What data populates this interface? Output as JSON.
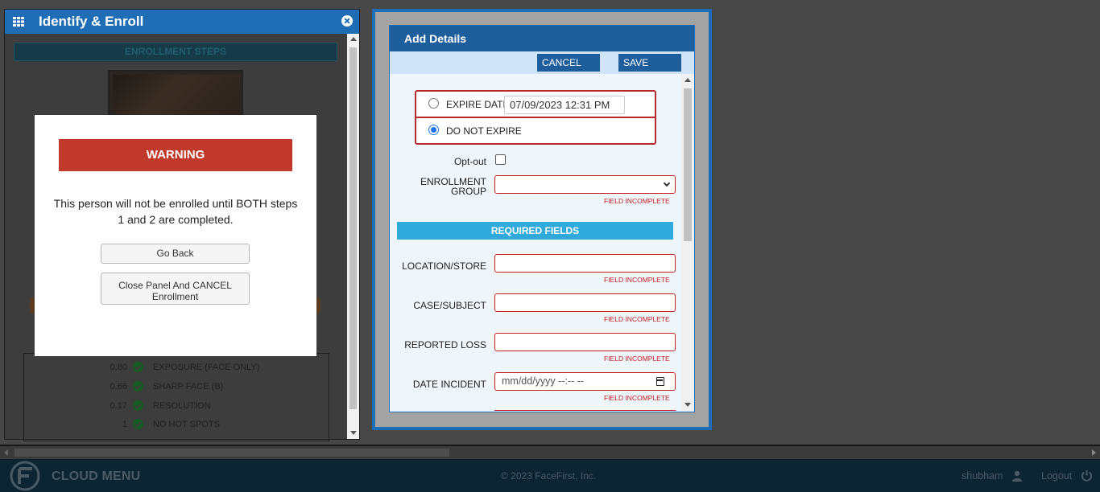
{
  "left_panel": {
    "title": "Identify & Enroll",
    "steps_title": "ENROLLMENT STEPS",
    "quality_rows": [
      {
        "value": "0.80",
        "label": "EXPOSURE (FACE ONLY)"
      },
      {
        "value": "0.66",
        "label": "SHARP FACE (B)"
      },
      {
        "value": "0.17",
        "label": "RESOLUTION"
      },
      {
        "value": "1",
        "label": "NO HOT SPOTS"
      }
    ]
  },
  "warning_modal": {
    "title": "WARNING",
    "message": "This person will not be enrolled until BOTH steps 1 and 2 are completed.",
    "go_back_label": "Go Back",
    "close_panel_label": "Close Panel And CANCEL Enrollment"
  },
  "add_details": {
    "title": "Add Details",
    "cancel_label": "CANCEL",
    "save_label": "SAVE",
    "expire_date_label": "EXPIRE DATE",
    "expire_date_value": "07/09/2023 12:31 PM",
    "do_not_expire_label": "DO NOT EXPIRE",
    "selected_expiry": "DO NOT EXPIRE",
    "optout_label": "Opt-out",
    "enrollment_group_label": "ENROLLMENT GROUP",
    "field_incomplete": "FIELD INCOMPLETE",
    "required_fields_title": "REQUIRED FIELDS",
    "location_label": "LOCATION/STORE",
    "case_label": "CASE/SUBJECT",
    "loss_label": "REPORTED LOSS",
    "date_label": "DATE INCIDENT",
    "date_placeholder": "mm/dd/yyyy --:-- --"
  },
  "footer": {
    "menu_label": "CLOUD MENU",
    "copyright": "© 2023 FaceFirst, Inc.",
    "username": "shubham",
    "logout_label": "Logout"
  },
  "colors": {
    "header_blue": "#1f6db5",
    "warning_red": "#c0392b",
    "required_blue": "#30a9db",
    "incomplete_red": "#c41e1e",
    "footer_navy": "#0d2433"
  },
  "icons": [
    "grid-icon",
    "close-icon",
    "check-icon",
    "chevron-down-icon",
    "calendar-icon",
    "user-icon",
    "power-icon",
    "logo-icon"
  ]
}
